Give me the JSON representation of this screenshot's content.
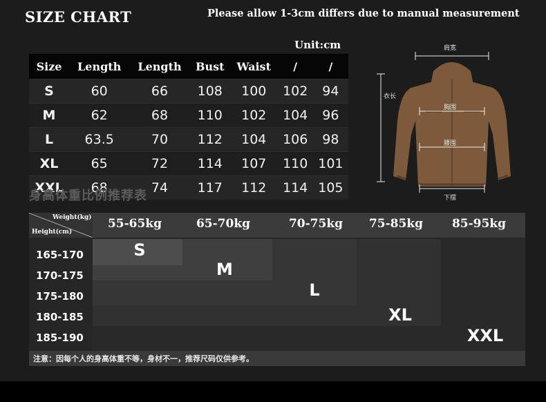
{
  "title": "SIZE CHART",
  "notice": "Please allow 1-3cm differs due to manual measurement",
  "unit": "Unit:cm",
  "size_table": {
    "headers": [
      "Size",
      "Length",
      "Length",
      "Bust",
      "Waist",
      "/",
      "/"
    ],
    "rows": [
      [
        "S",
        "60",
        "66",
        "108",
        "100",
        "102",
        "94"
      ],
      [
        "M",
        "62",
        "68",
        "110",
        "102",
        "104",
        "96"
      ],
      [
        "L",
        "63.5",
        "70",
        "112",
        "104",
        "106",
        "98"
      ],
      [
        "XL",
        "65",
        "72",
        "114",
        "107",
        "110",
        "101"
      ],
      [
        "XXL",
        "68",
        "74",
        "117",
        "112",
        "114",
        "105"
      ]
    ]
  },
  "reference_title": "身高体重比例推荐表",
  "diagram": {
    "shoulder": "肩宽",
    "length": "衣长",
    "chest": "胸围",
    "waist": "腰围",
    "hem": "下摆",
    "jacket_color": "#7d5a3c"
  },
  "grid": {
    "corner_weight": "Weight(kg)",
    "corner_height": "Height(cm)",
    "weights": [
      "55-65kg",
      "65-70kg",
      "70-75kg",
      "75-85kg",
      "85-95kg"
    ],
    "heights": [
      "165-170",
      "170-175",
      "175-180",
      "180-185",
      "185-190"
    ],
    "sizes": [
      "S",
      "M",
      "L",
      "XL",
      "XXL"
    ],
    "note": "注意：因每个人的身高体重不等，身材不一，推荐尺码仅供参考。"
  }
}
